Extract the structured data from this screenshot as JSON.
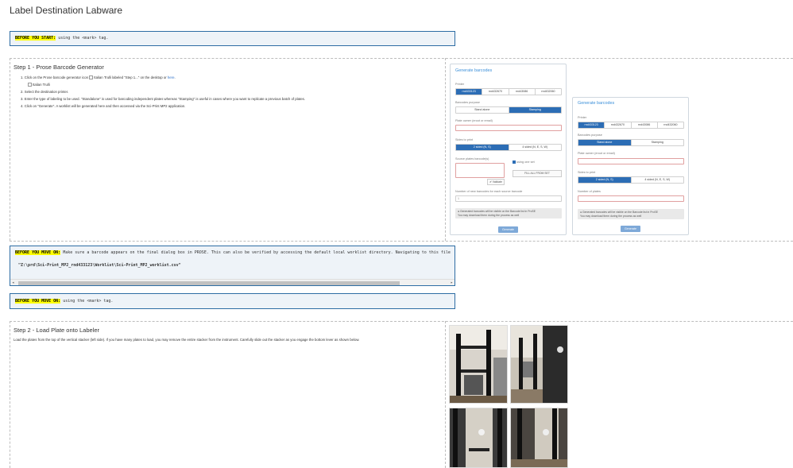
{
  "page": {
    "title": "Label Destination Labware"
  },
  "callout_start": {
    "mark": "BEFORE YOU START:",
    "text": " using the <mark> tag."
  },
  "step1": {
    "title": "Step 1 - Prose Barcode Generator",
    "item1_before": "1. Click on the Prose barcode generator icon ",
    "item1_img_alt": "Italian Trulli",
    "item1_after": " labeled \"Step 1...\" on the desktop or ",
    "item1_link": "here",
    "item1_end": ".",
    "item1_img2_alt": "Italian Trulli",
    "item2": "2. Select the destination printer.",
    "item3": "3. Enter the type of labeling to be used. \"Standalone\" is used for barcoding independent plates whereas \"Stamping\" is useful in cases where you want to replicate a previous batch of plates.",
    "item4": "4. Click on \"Generate\". A worklist will be generated here and then accessed via the Sci-Print MP2 application."
  },
  "panel_large": {
    "title": "Generate barcodes",
    "printer_label": "Printer",
    "printers": [
      "rnd433123",
      "rnd432670",
      "rnd43086",
      "rnd432060"
    ],
    "printer_selected": 0,
    "purpose_label": "Barcodes purpose",
    "purposes": [
      "Stand alone",
      "Stamping"
    ],
    "purpose_selected": 1,
    "owner_label": "Plate owner (eroot or email)",
    "sides_label": "Sides to print",
    "sides": [
      "2 sided (N, S)",
      "4 sided (N, E, S, W)"
    ],
    "sides_selected": 0,
    "source_label": "Source plates barcode(s)",
    "using_one_set": "using one set",
    "fill_all": "FILL ALL FROM SET",
    "validate": "Validate",
    "count_label": "Number of new barcodes for each source barcode",
    "count_value": "1",
    "note_line1": "Generated barcodes will be visible on the Barcode list in ProSE",
    "note_line2": "You may download them during the process as well",
    "generate": "Generate"
  },
  "panel_small": {
    "title": "Generate barcodes",
    "printer_label": "Printer",
    "printers": [
      "rnd433123",
      "rnd432670",
      "rnd43086",
      "rnd432060"
    ],
    "printer_selected": 0,
    "purpose_label": "Barcodes purpose",
    "purposes": [
      "Stand alone",
      "Stamping"
    ],
    "purpose_selected": 0,
    "owner_label": "Plate owner (eroot or email)",
    "sides_label": "Sides to print",
    "sides": [
      "2 sided (N, S)",
      "4 sided (N, E, S, W)"
    ],
    "sides_selected": 0,
    "count_label": "Number of plates",
    "note_line1": "Generated barcodes will be visible on the Barcode list in ProSE",
    "note_line2": "You may download them during the process as well",
    "generate": "Generate"
  },
  "callout_moveon_1": {
    "mark": "BEFORE YOU MOVE ON:",
    "text": " Make sure a barcode appears on the final dialog box in PROSE. This can also be verified by accessing the default local worklist directory. Navigating to this file",
    "path": "\"Z:\\prd\\Sci-Print_MP2_rnd433123\\Worklist\\Sci-Print_MP2_worklist.csv\""
  },
  "callout_moveon_2": {
    "mark": "BEFORE YOU MOVE ON:",
    "text": " using the <mark> tag."
  },
  "step2": {
    "title": "Step 2 - Load Plate onto Labeler",
    "text": "Load the plates from the top of the vertical stacker (left side). If you have many plates to load, you may remove the entire stacker from the instrument. Carefully slide out the stacker as you engage the bottom lever as shown below."
  },
  "colors": {
    "accent": "#2c6db5",
    "callout_border": "#2e6da4",
    "mark": "#ffff00",
    "panel_title": "#3b8fd9"
  }
}
